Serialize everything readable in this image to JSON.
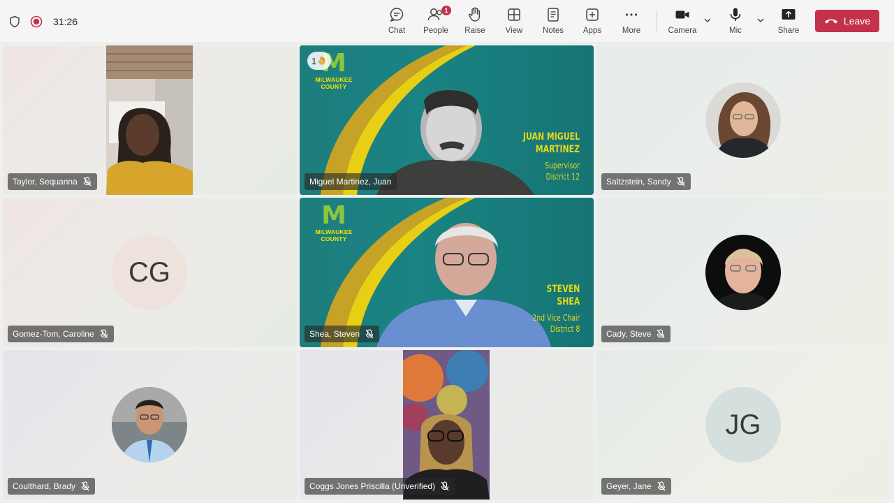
{
  "meeting": {
    "timer": "31:26"
  },
  "toolbar": {
    "chat": "Chat",
    "people": "People",
    "people_badge": "1",
    "raise": "Raise",
    "view": "View",
    "notes": "Notes",
    "apps": "Apps",
    "more": "More",
    "camera": "Camera",
    "mic": "Mic",
    "share": "Share",
    "leave": "Leave"
  },
  "colors": {
    "accent": "#5b5fc7",
    "leave": "#c4314b",
    "brand_teal": "#1a8383",
    "brand_yellow": "#e5d919"
  },
  "participants": [
    {
      "name": "Taylor, Sequanna",
      "mode": "video",
      "muted": true
    },
    {
      "name": "Miguel Martinez, Juan",
      "mode": "branded-video",
      "muted": false,
      "speaking": true,
      "raised_hand_count": "1",
      "banner_org": "MILWAUKEE COUNTY",
      "banner_name_1": "JUAN MIGUEL",
      "banner_name_2": "MARTINEZ",
      "banner_title_1": "Supervisor",
      "banner_title_2": "District 12"
    },
    {
      "name": "Saltzstein, Sandy",
      "mode": "avatar",
      "muted": true
    },
    {
      "name": "Gomez-Tom, Caroline",
      "mode": "initials",
      "initials": "CG",
      "muted": true
    },
    {
      "name": "Shea, Steven",
      "mode": "branded-video",
      "muted": true,
      "banner_org": "MILWAUKEE COUNTY",
      "banner_name_1": "STEVEN",
      "banner_name_2": "SHEA",
      "banner_title_1": "2nd Vice Chair",
      "banner_title_2": "District 8"
    },
    {
      "name": "Cady, Steve",
      "mode": "avatar",
      "muted": true
    },
    {
      "name": "Coulthard, Brady",
      "mode": "avatar",
      "muted": true
    },
    {
      "name": "Coggs Jones Priscilla (Unverified)",
      "mode": "video",
      "muted": true
    },
    {
      "name": "Geyer, Jane",
      "mode": "initials",
      "initials": "JG",
      "muted": true
    }
  ]
}
